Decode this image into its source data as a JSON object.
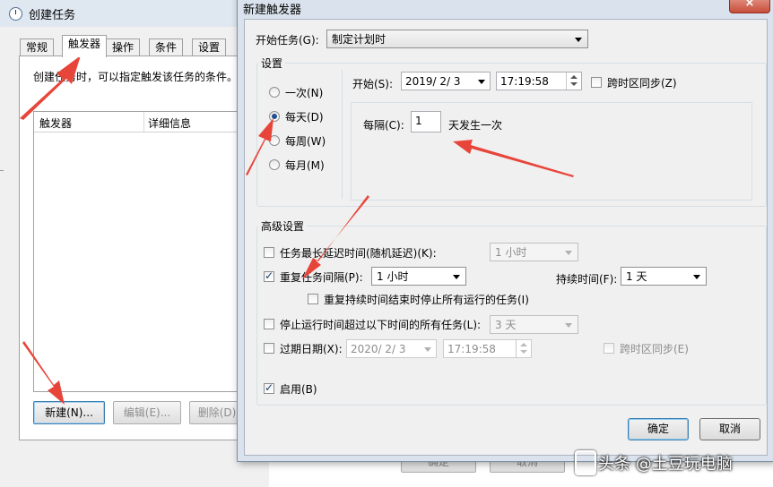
{
  "background_window": {
    "title": "创建任务",
    "tabs": [
      "常规",
      "触发器",
      "操作",
      "条件",
      "设置"
    ],
    "description": "创建任务时，可以指定触发该任务的条件。",
    "list_columns": [
      "触发器",
      "详细信息"
    ],
    "buttons": {
      "new": "新建(N)...",
      "edit": "编辑(E)...",
      "delete": "删除(D)"
    },
    "bottom_buttons": {
      "ok": "确定",
      "cancel": "取消"
    }
  },
  "dialog": {
    "title": "新建触发器",
    "close_icon": "×",
    "start_task_label": "开始任务(G):",
    "start_task_value": "制定计划时",
    "settings_title": "设置",
    "schedule_options": [
      {
        "label": "一次(N)",
        "checked": false
      },
      {
        "label": "每天(D)",
        "checked": true
      },
      {
        "label": "每周(W)",
        "checked": false
      },
      {
        "label": "每月(M)",
        "checked": false
      }
    ],
    "start_label": "开始(S):",
    "start_date": "2019/  2/  3",
    "start_time": "17:19:58",
    "sync_timezone": "跨时区同步(Z)",
    "recur_label": "每隔(C):",
    "recur_value": "1",
    "recur_suffix": "天发生一次",
    "advanced_title": "高级设置",
    "delay_label": "任务最长延迟时间(随机延迟)(K):",
    "delay_value": "1 小时",
    "repeat_label": "重复任务间隔(P):",
    "repeat_checked": true,
    "repeat_value": "1 小时",
    "duration_label": "持续时间(F):",
    "duration_value": "1 天",
    "stop_all_label": "重复持续时间结束时停止所有运行的任务(I)",
    "stop_longer_label": "停止运行时间超过以下时间的所有任务(L):",
    "stop_longer_value": "3 天",
    "expire_label": "过期日期(X):",
    "expire_date": "2020/  2/  3",
    "expire_time": "17:19:58",
    "expire_sync": "跨时区同步(E)",
    "enabled_label": "启用(B)",
    "enabled_checked": true,
    "ok": "确定",
    "cancel": "取消"
  },
  "watermark": "头条 @土豆玩电脑",
  "colors": {
    "arrow": "#e8453a",
    "dialog_frame": "#dae3ed",
    "close_button": "#c74d3a"
  }
}
